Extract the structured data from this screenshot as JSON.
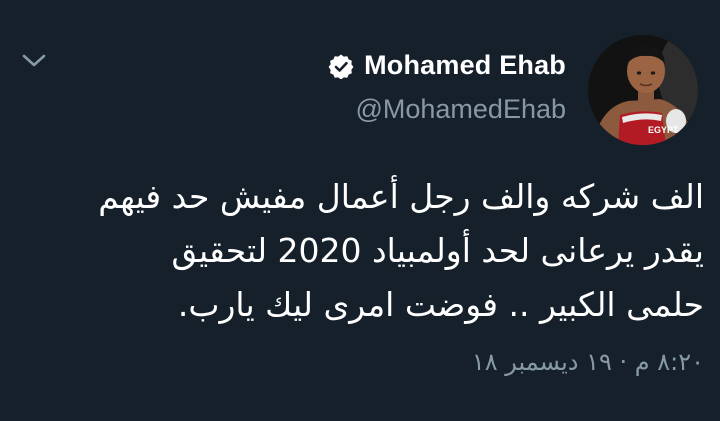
{
  "author": {
    "name": "Mohamed Ehab",
    "handle": "@MohamedEhab",
    "verified": true,
    "avatar_jersey_text": "EGYPT"
  },
  "tweet": {
    "text_lines": [
      "الف شركه والف رجل أعمال مفيش حد فيهم",
      "يقدر يرعانى لحد أولمبياد 2020 لتحقيق",
      "حلمى الكبير .. فوضت امرى ليك يارب."
    ],
    "timestamp": "٨:٢٠ م · ١٩ ديسمبر ١٨"
  },
  "icons": {
    "menu": "chevron-down-icon",
    "verified": "verified-badge-icon"
  },
  "colors": {
    "background": "#15202b",
    "primary_text": "#ffffff",
    "secondary_text": "#8899a6"
  }
}
